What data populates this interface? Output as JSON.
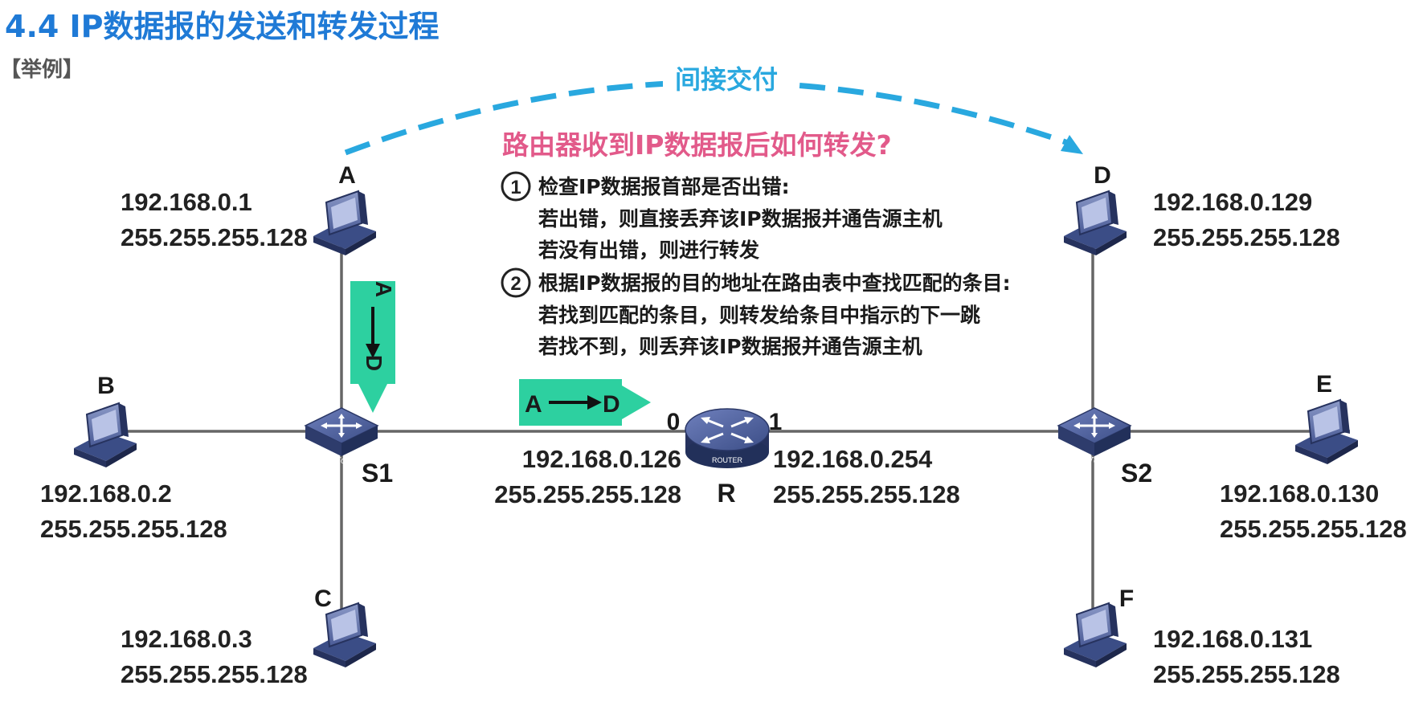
{
  "header": {
    "title": "4.4  IP数据报的发送和转发过程",
    "example_tag": "【举例】"
  },
  "colors": {
    "title": "#1f7ad6",
    "indirect_arc": "#29a8df",
    "question": "#e25a8a",
    "packet_box": "#2dd0a0",
    "link": "#666666",
    "device": "#3b4d86"
  },
  "indirect_delivery": {
    "label": "间接交付"
  },
  "question": {
    "text": "路由器收到IP数据报后如何转发?"
  },
  "steps": [
    {
      "num": "1",
      "lines": [
        "检查IP数据报首部是否出错:",
        "若出错，则直接丢弃该IP数据报并通告源主机",
        "若没有出错，则进行转发"
      ]
    },
    {
      "num": "2",
      "lines": [
        "根据IP数据报的目的地址在路由表中查找匹配的条目:",
        "若找到匹配的条目，则转发给条目中指示的下一跳",
        "若找不到，则丢弃该IP数据报并通告源主机"
      ]
    }
  ],
  "packet_vertical": {
    "src": "A",
    "dst": "D"
  },
  "packet_horizontal": {
    "src": "A",
    "dst": "D"
  },
  "hosts": [
    {
      "name": "A",
      "ip": "192.168.0.1",
      "mask": "255.255.255.128",
      "icon": "computer-icon"
    },
    {
      "name": "B",
      "ip": "192.168.0.2",
      "mask": "255.255.255.128",
      "icon": "computer-icon"
    },
    {
      "name": "C",
      "ip": "192.168.0.3",
      "mask": "255.255.255.128",
      "icon": "computer-icon"
    },
    {
      "name": "D",
      "ip": "192.168.0.129",
      "mask": "255.255.255.128",
      "icon": "computer-icon"
    },
    {
      "name": "E",
      "ip": "192.168.0.130",
      "mask": "255.255.255.128",
      "icon": "computer-icon"
    },
    {
      "name": "F",
      "ip": "192.168.0.131",
      "mask": "255.255.255.128",
      "icon": "computer-icon"
    }
  ],
  "switches": [
    {
      "name": "S1",
      "badge": "SWITCH",
      "icon": "switch-icon"
    },
    {
      "name": "S2",
      "badge": "SWITCH",
      "icon": "switch-icon"
    }
  ],
  "router": {
    "name": "R",
    "badge": "ROUTER",
    "icon": "router-icon",
    "interfaces": [
      {
        "id": "0",
        "ip": "192.168.0.126",
        "mask": "255.255.255.128"
      },
      {
        "id": "1",
        "ip": "192.168.0.254",
        "mask": "255.255.255.128"
      }
    ]
  }
}
